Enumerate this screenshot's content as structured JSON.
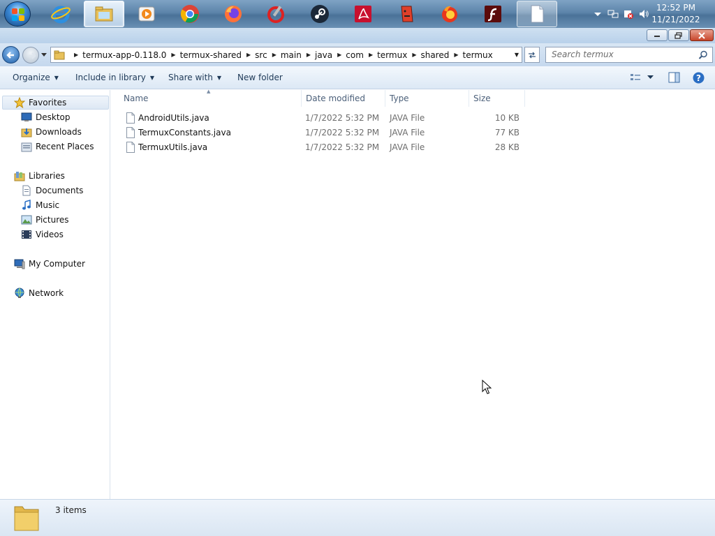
{
  "taskbar": {
    "apps": [
      {
        "icon": "internet-explorer-icon",
        "state": "normal"
      },
      {
        "icon": "windows-explorer-icon",
        "state": "active"
      },
      {
        "icon": "media-player-icon",
        "state": "normal"
      },
      {
        "icon": "chrome-icon",
        "state": "normal"
      },
      {
        "icon": "firefox-icon",
        "state": "normal"
      },
      {
        "icon": "ccleaner-icon",
        "state": "normal"
      },
      {
        "icon": "steam-icon",
        "state": "normal"
      },
      {
        "icon": "adobe-reader-icon",
        "state": "normal"
      },
      {
        "icon": "red-head-app-icon",
        "state": "normal"
      },
      {
        "icon": "firefox-nightly-icon",
        "state": "normal"
      },
      {
        "icon": "flash-player-icon",
        "state": "normal"
      },
      {
        "icon": "blank-document-icon",
        "state": "open"
      }
    ],
    "clock": {
      "time": "12:52 PM",
      "date": "11/21/2022"
    }
  },
  "address": {
    "breadcrumbs": [
      "termux-app-0.118.0",
      "termux-shared",
      "src",
      "main",
      "java",
      "com",
      "termux",
      "shared",
      "termux"
    ]
  },
  "search": {
    "placeholder": "Search termux"
  },
  "toolbar": {
    "organize": "Organize",
    "include_in_library": "Include in library",
    "share_with": "Share with",
    "new_folder": "New folder"
  },
  "navpane": {
    "favorites": "Favorites",
    "desktop": "Desktop",
    "downloads": "Downloads",
    "recent_places": "Recent Places",
    "libraries": "Libraries",
    "documents": "Documents",
    "music": "Music",
    "pictures": "Pictures",
    "videos": "Videos",
    "my_computer": "My Computer",
    "network": "Network"
  },
  "filelist": {
    "columns": {
      "name": "Name",
      "date": "Date modified",
      "type": "Type",
      "size": "Size"
    },
    "files": [
      {
        "name": "AndroidUtils.java",
        "date": "1/7/2022 5:32 PM",
        "type": "JAVA File",
        "size": "10 KB"
      },
      {
        "name": "TermuxConstants.java",
        "date": "1/7/2022 5:32 PM",
        "type": "JAVA File",
        "size": "77 KB"
      },
      {
        "name": "TermuxUtils.java",
        "date": "1/7/2022 5:32 PM",
        "type": "JAVA File",
        "size": "28 KB"
      }
    ]
  },
  "status": {
    "item_count": "3 items"
  },
  "colors": {
    "accent": "#1f5fa8",
    "toolbar_text": "#1e3957",
    "close_red": "#c7452a"
  }
}
